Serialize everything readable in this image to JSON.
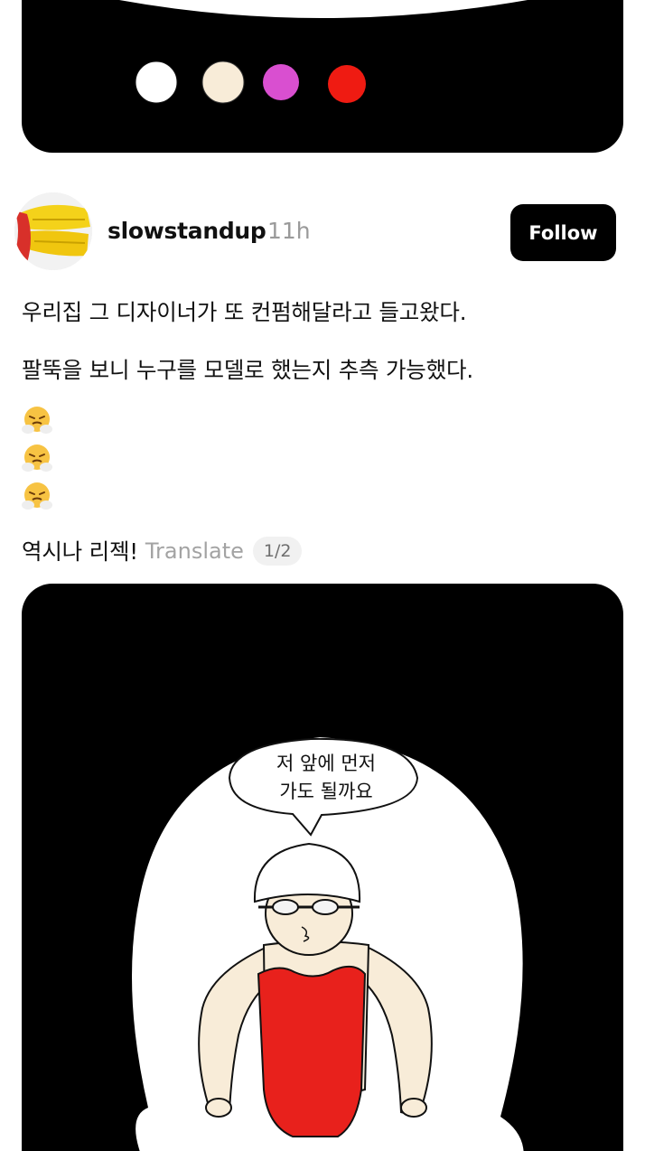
{
  "post": {
    "username": "slowstandup",
    "timestamp": "11h",
    "follow_label": "Follow",
    "lines": [
      "우리집 그 디자이너가 또 컨펌해달라고 들고왔다.",
      "팔뚝을 보니 누구를 모델로 했는지 추측 가능했다."
    ],
    "emoji_name": "face-with-steam-emoji",
    "last_line": "역시나 리젝!",
    "translate_label": "Translate",
    "page_indicator": "1/2"
  },
  "illustration": {
    "speech_line1": "저 앞에 먼저",
    "speech_line2": "가도 될까요"
  },
  "colors": {
    "image_bg": "#000000",
    "swatches": [
      "#ffffff",
      "#f8ecd8",
      "#d94fd0",
      "#ef1b12"
    ],
    "swimsuit": "#e8211c",
    "skin": "#f8ecd8"
  }
}
